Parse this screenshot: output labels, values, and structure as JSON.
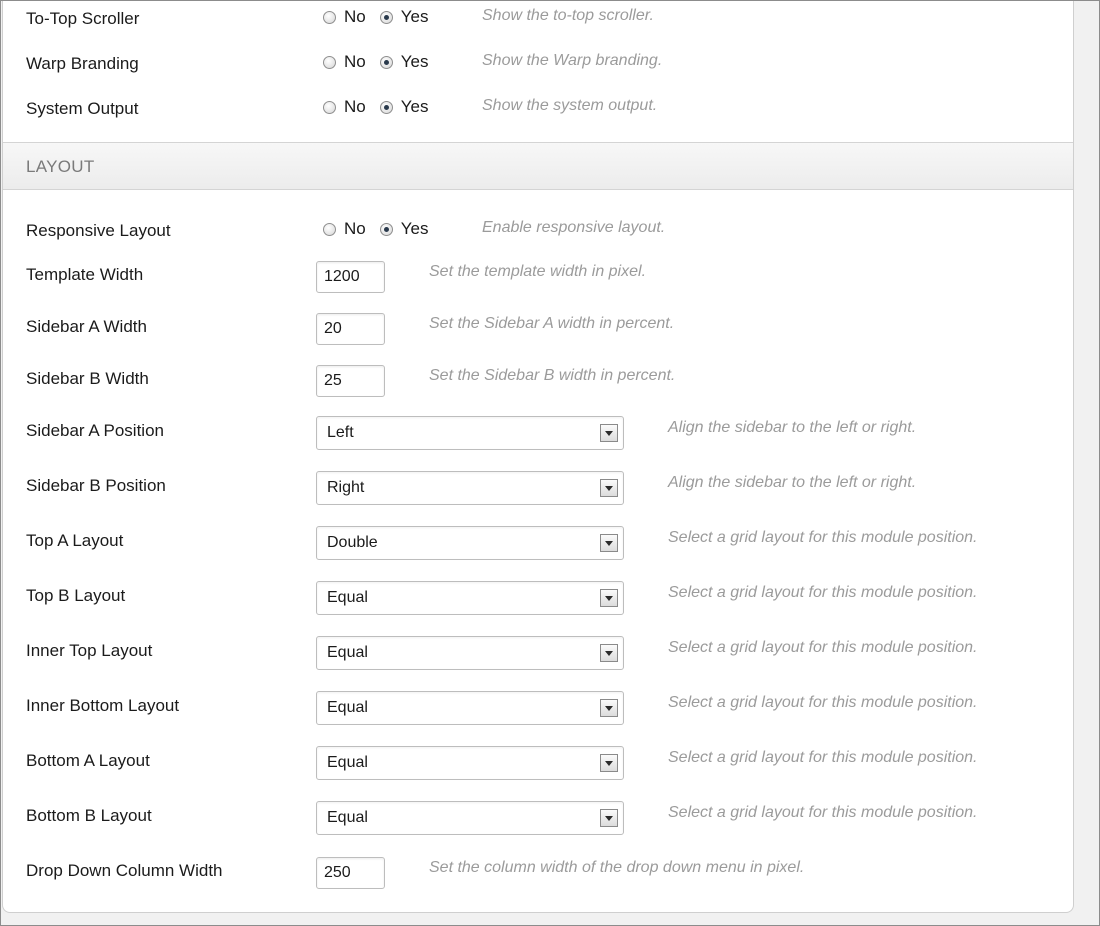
{
  "radio_options": {
    "no": "No",
    "yes": "Yes"
  },
  "top_rows": [
    {
      "label": "To-Top Scroller",
      "hint": "Show the to-top scroller.",
      "value": "Yes"
    },
    {
      "label": "Warp Branding",
      "hint": "Show the Warp branding.",
      "value": "Yes"
    },
    {
      "label": "System Output",
      "hint": "Show the system output.",
      "value": "Yes"
    }
  ],
  "layout_section": {
    "title": "LAYOUT",
    "responsive": {
      "label": "Responsive Layout",
      "hint": "Enable responsive layout.",
      "value": "Yes"
    },
    "template_width": {
      "label": "Template Width",
      "value": "1200",
      "hint": "Set the template width in pixel."
    },
    "sidebar_a_width": {
      "label": "Sidebar A Width",
      "value": "20",
      "hint": "Set the Sidebar A width in percent."
    },
    "sidebar_b_width": {
      "label": "Sidebar B Width",
      "value": "25",
      "hint": "Set the Sidebar B width in percent."
    },
    "sidebar_a_position": {
      "label": "Sidebar A Position",
      "value": "Left",
      "hint": "Align the sidebar to the left or right."
    },
    "sidebar_b_position": {
      "label": "Sidebar B Position",
      "value": "Right",
      "hint": "Align the sidebar to the left or right."
    },
    "top_a_layout": {
      "label": "Top A Layout",
      "value": "Double",
      "hint": "Select a grid layout for this module position."
    },
    "top_b_layout": {
      "label": "Top B Layout",
      "value": "Equal",
      "hint": "Select a grid layout for this module position."
    },
    "inner_top_layout": {
      "label": "Inner Top Layout",
      "value": "Equal",
      "hint": "Select a grid layout for this module position."
    },
    "inner_bottom_layout": {
      "label": "Inner Bottom Layout",
      "value": "Equal",
      "hint": "Select a grid layout for this module position."
    },
    "bottom_a_layout": {
      "label": "Bottom A Layout",
      "value": "Equal",
      "hint": "Select a grid layout for this module position."
    },
    "bottom_b_layout": {
      "label": "Bottom B Layout",
      "value": "Equal",
      "hint": "Select a grid layout for this module position."
    },
    "dropdown_column_width": {
      "label": "Drop Down Column Width",
      "value": "250",
      "hint": "Set the column width of the drop down menu in pixel."
    }
  }
}
